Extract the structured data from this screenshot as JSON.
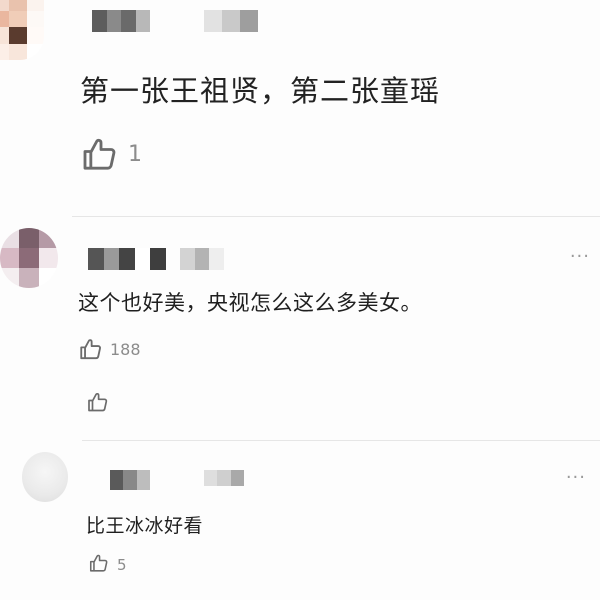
{
  "comments": [
    {
      "text": "第一张王祖贤，第二张童瑶",
      "likes": "1",
      "like_icon": "thumbs-up-icon"
    },
    {
      "text": "这个也好美，央视怎么这么多美女。",
      "likes": "188",
      "like_icon": "thumbs-up-icon",
      "more_icon": "more-dots-icon",
      "more_label": "···"
    },
    {
      "text": "比王冰冰好看",
      "likes": "5",
      "like_icon": "thumbs-up-icon",
      "more_icon": "more-dots-icon",
      "more_label": "···"
    }
  ],
  "colors": {
    "text": "#1f1f1f",
    "muted": "#8c8c8c",
    "divider": "#e6e6e6"
  }
}
